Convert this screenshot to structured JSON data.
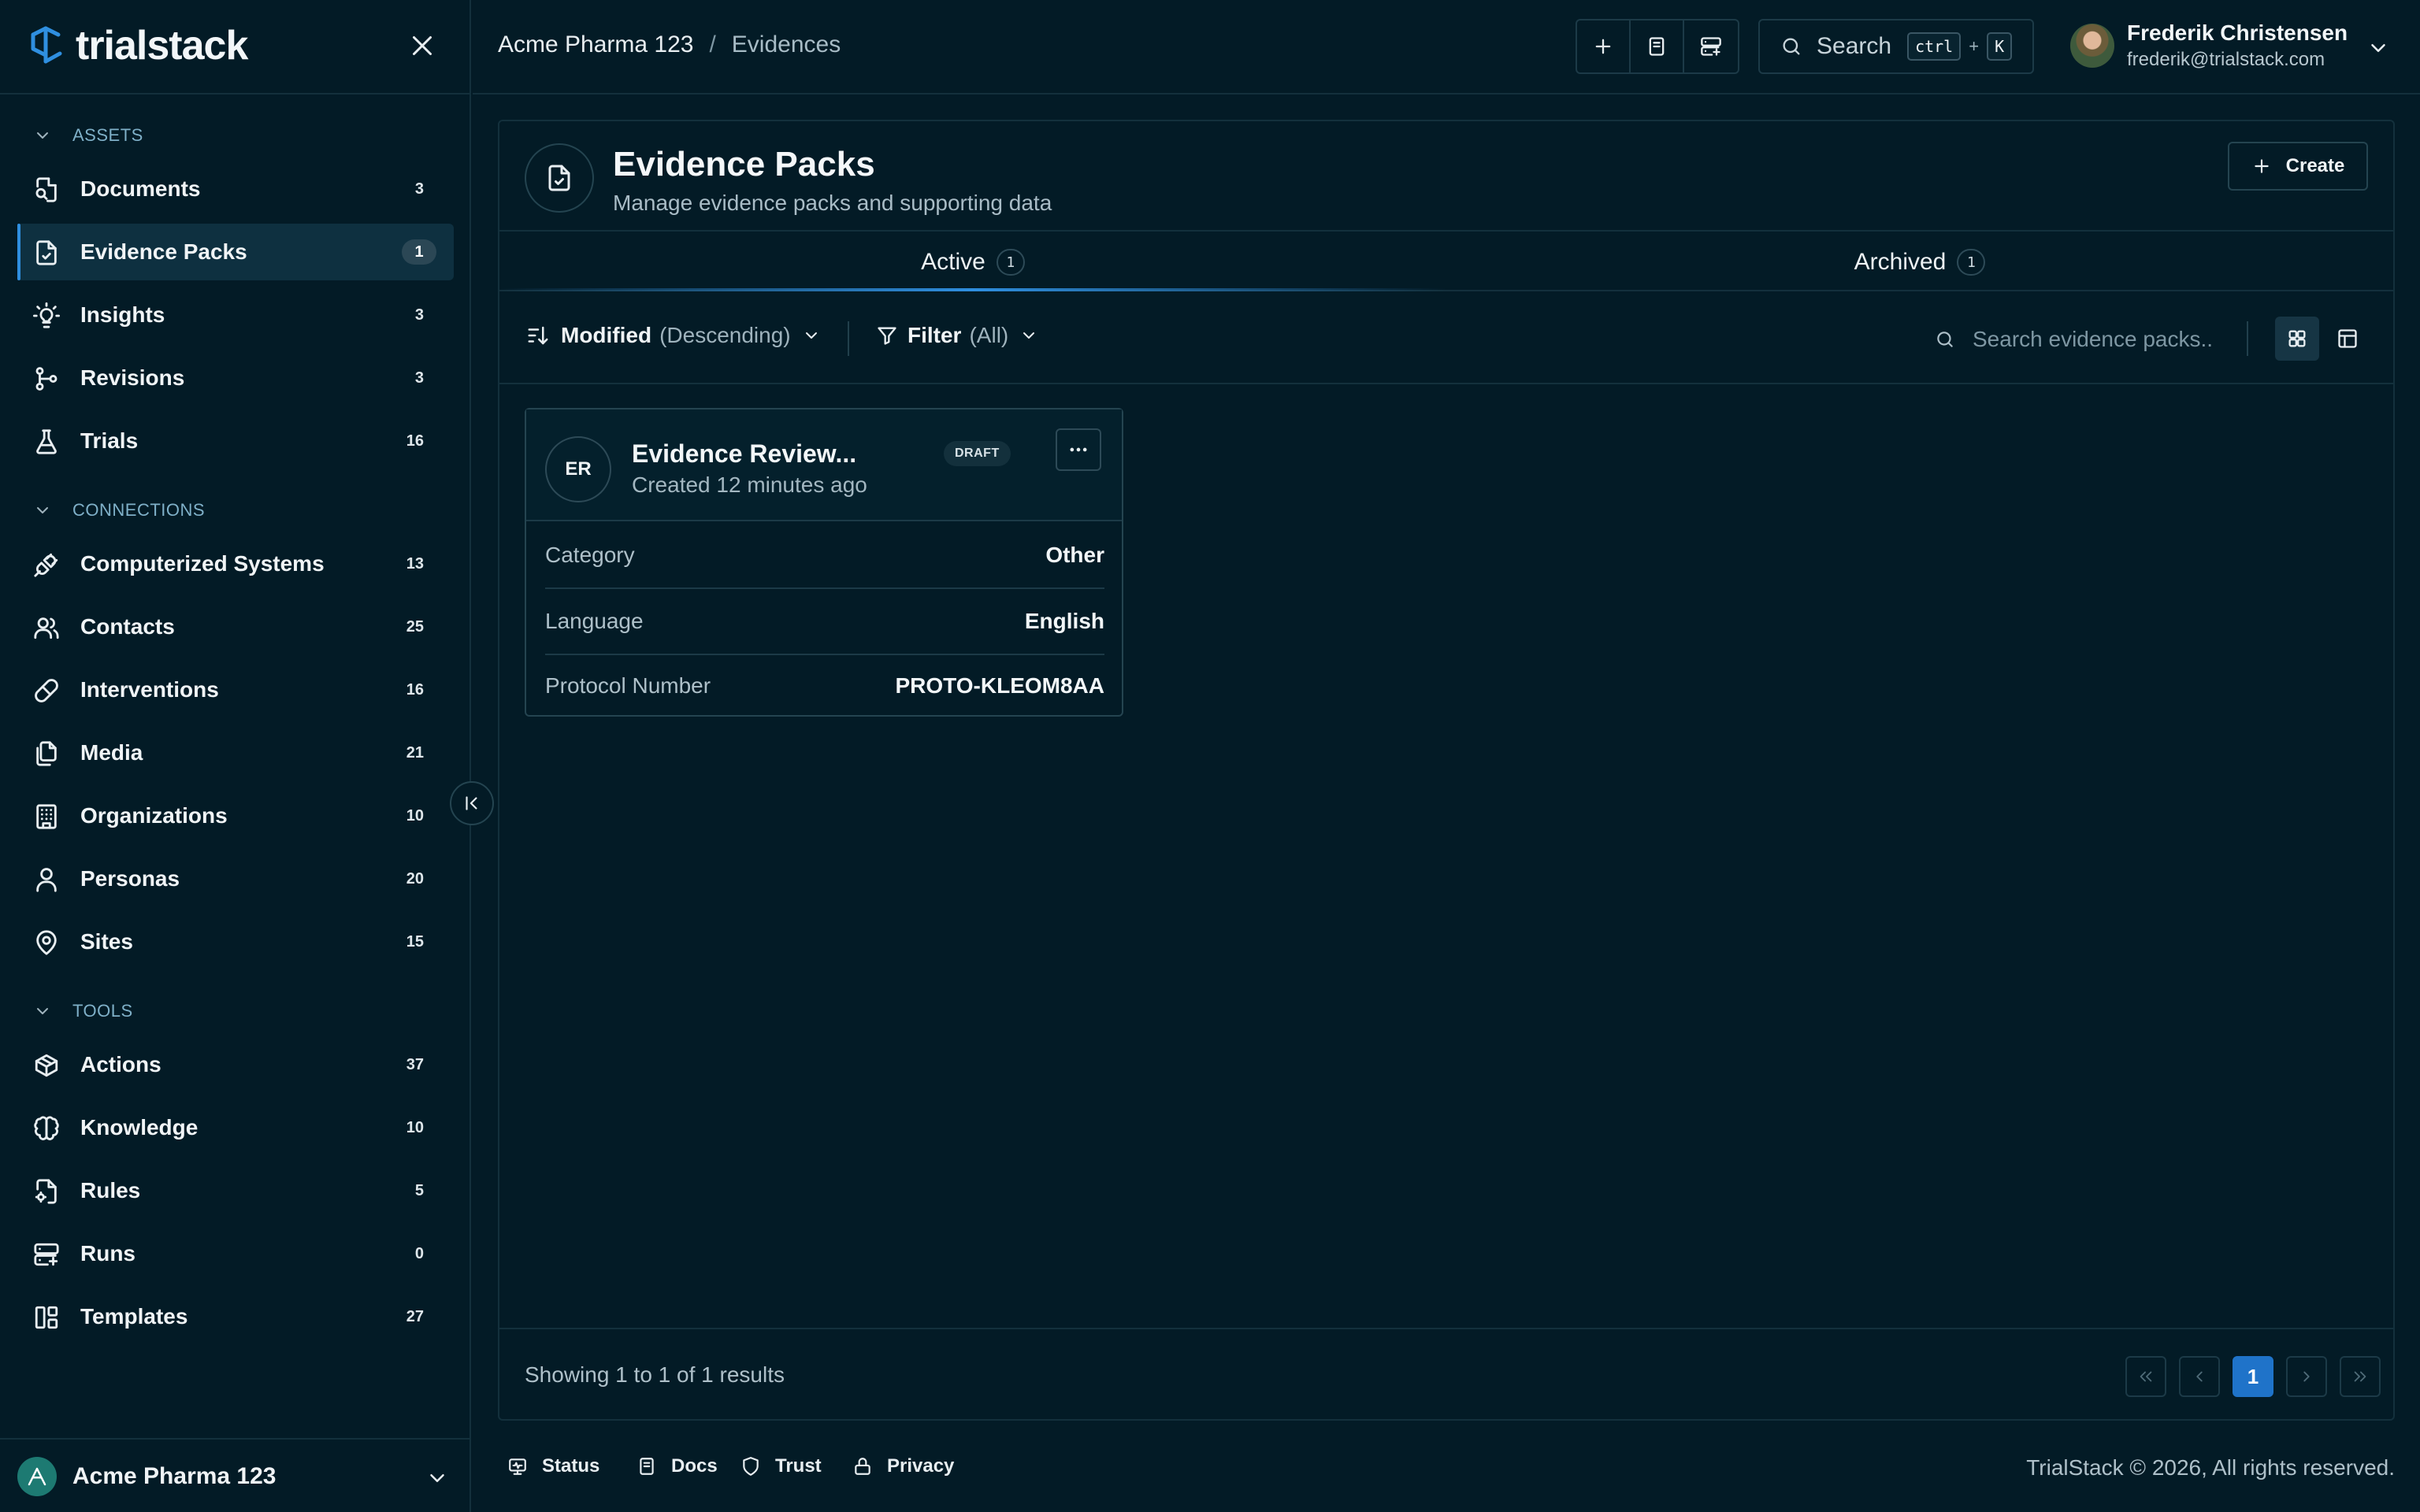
{
  "app": {
    "logo_text": "trialstack"
  },
  "sidebar": {
    "sections": [
      {
        "label": "ASSETS"
      },
      {
        "label": "CONNECTIONS"
      },
      {
        "label": "TOOLS"
      }
    ],
    "items": [
      {
        "label": "Documents",
        "count": "3",
        "icon": "document-search-icon"
      },
      {
        "label": "Evidence Packs",
        "count": "1",
        "icon": "file-check-icon",
        "active": true
      },
      {
        "label": "Insights",
        "count": "3",
        "icon": "lightbulb-icon"
      },
      {
        "label": "Revisions",
        "count": "3",
        "icon": "git-branch-icon"
      },
      {
        "label": "Trials",
        "count": "16",
        "icon": "flask-icon"
      },
      {
        "label": "Computerized Systems",
        "count": "13",
        "icon": "plug-icon"
      },
      {
        "label": "Contacts",
        "count": "25",
        "icon": "users-icon"
      },
      {
        "label": "Interventions",
        "count": "16",
        "icon": "pill-icon"
      },
      {
        "label": "Media",
        "count": "21",
        "icon": "files-icon"
      },
      {
        "label": "Organizations",
        "count": "10",
        "icon": "building-icon"
      },
      {
        "label": "Personas",
        "count": "20",
        "icon": "user-icon"
      },
      {
        "label": "Sites",
        "count": "15",
        "icon": "map-pin-icon"
      },
      {
        "label": "Actions",
        "count": "37",
        "icon": "package-icon"
      },
      {
        "label": "Knowledge",
        "count": "10",
        "icon": "brain-icon"
      },
      {
        "label": "Rules",
        "count": "5",
        "icon": "file-cog-icon"
      },
      {
        "label": "Runs",
        "count": "0",
        "icon": "server-icon"
      },
      {
        "label": "Templates",
        "count": "27",
        "icon": "layout-icon"
      }
    ],
    "org_name": "Acme Pharma 123"
  },
  "header": {
    "breadcrumb": {
      "org": "Acme Pharma 123",
      "separator": "/",
      "page": "Evidences"
    },
    "search": {
      "label": "Search",
      "kbd_ctrl": "ctrl",
      "kbd_plus": "+",
      "kbd_key": "K"
    },
    "user": {
      "name": "Frederik Christensen",
      "email": "frederik@trialstack.com"
    }
  },
  "page": {
    "title": "Evidence Packs",
    "subtitle": "Manage evidence packs and supporting data",
    "create_label": "Create",
    "tabs": [
      {
        "label": "Active",
        "count": "1",
        "active": true
      },
      {
        "label": "Archived",
        "count": "1"
      }
    ],
    "sort": {
      "field": "Modified",
      "direction": "(Descending)"
    },
    "filter": {
      "label": "Filter",
      "value": "(All)"
    },
    "search_placeholder": "Search evidence packs..",
    "view_mode": "grid"
  },
  "card": {
    "initials": "ER",
    "title": "Evidence Review...",
    "status": "DRAFT",
    "created": "Created 12 minutes ago",
    "rows": [
      {
        "key": "Category",
        "value": "Other"
      },
      {
        "key": "Language",
        "value": "English"
      },
      {
        "key": "Protocol Number",
        "value": "PROTO-KLEOM8AA"
      }
    ]
  },
  "pagination": {
    "summary": "Showing 1 to 1 of 1 results",
    "current_page": "1"
  },
  "footer": {
    "links": [
      "Status",
      "Docs",
      "Trust",
      "Privacy"
    ],
    "copyright": "TrialStack © 2026, All rights reserved."
  },
  "colors": {
    "background": "#031b26",
    "accent": "#2f8fe0",
    "active_page": "#1f73c9"
  }
}
